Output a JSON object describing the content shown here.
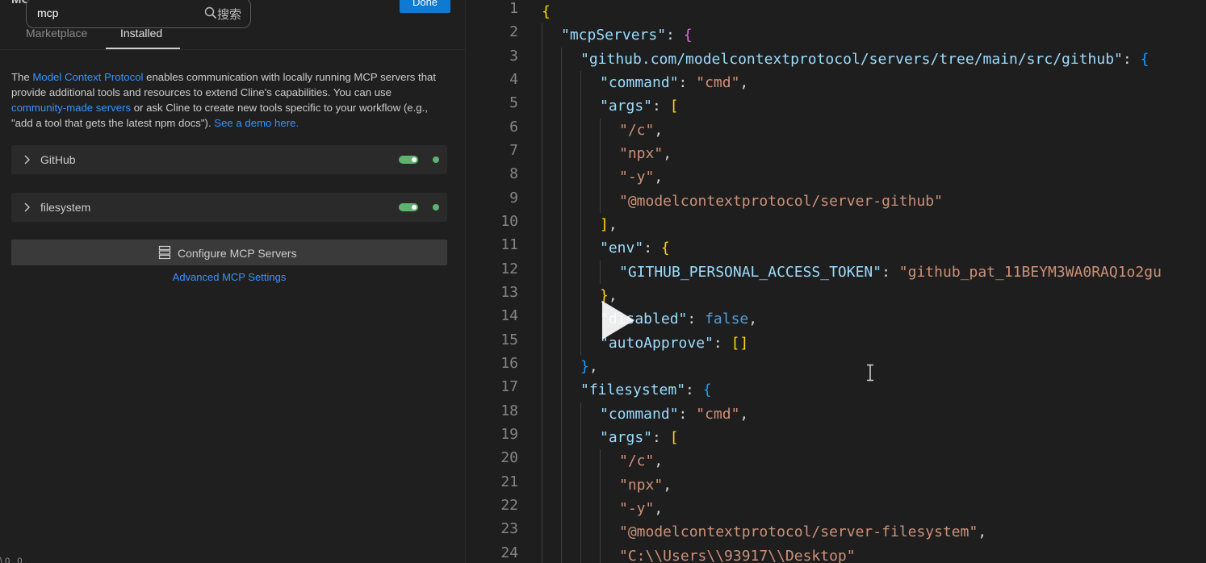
{
  "left_panel": {
    "title": "MCP Servers",
    "search": {
      "value": "mcp",
      "hint": "搜索"
    },
    "done_label": "Done",
    "tabs": [
      "Marketplace",
      "Installed"
    ],
    "intro": {
      "p1": "The ",
      "link1": "Model Context Protocol",
      "p2": " enables communication with locally running MCP servers that provide additional tools and resources to extend Cline's capabilities. You can use ",
      "link2": "community-made servers",
      "p3": " or ask Cline to create new tools specific to your workflow (e.g., \"add a tool that gets the latest npm docs\"). ",
      "link3": "See a demo here."
    },
    "servers": [
      {
        "name": "GitHub",
        "enabled": true
      },
      {
        "name": "filesystem",
        "enabled": true
      }
    ],
    "configure_label": "Configure MCP Servers",
    "advanced_label": "Advanced MCP Settings",
    "corner_text": "\\ 0 . 0 ."
  },
  "editor": {
    "line_numbers": [
      "1",
      "2",
      "3",
      "4",
      "5",
      "6",
      "7",
      "8",
      "9",
      "10",
      "11",
      "12",
      "13",
      "14",
      "15",
      "16",
      "17",
      "18",
      "19",
      "20",
      "21",
      "22",
      "23",
      "24"
    ],
    "tokens": {
      "mcpServers": "\"mcpServers\"",
      "github_key": "\"github.com/modelcontextprotocol/servers/tree/main/src/github\"",
      "command": "\"command\"",
      "cmd": "\"cmd\"",
      "args": "\"args\"",
      "slash_c": "\"/c\"",
      "npx": "\"npx\"",
      "dash_y": "\"-y\"",
      "server_github": "\"@modelcontextprotocol/server-github\"",
      "env": "\"env\"",
      "token_key": "\"GITHUB_PERSONAL_ACCESS_TOKEN\"",
      "token_val": "\"github_pat_11BEYM3WA0RAQ1o2gu",
      "disabled": "\"disabled\"",
      "false": "false",
      "autoApprove": "\"autoApprove\"",
      "filesystem": "\"filesystem\"",
      "server_fs": "\"@modelcontextprotocol/server-filesystem\"",
      "path": "\"C:\\\\Users\\\\93917\\\\Desktop\""
    }
  }
}
